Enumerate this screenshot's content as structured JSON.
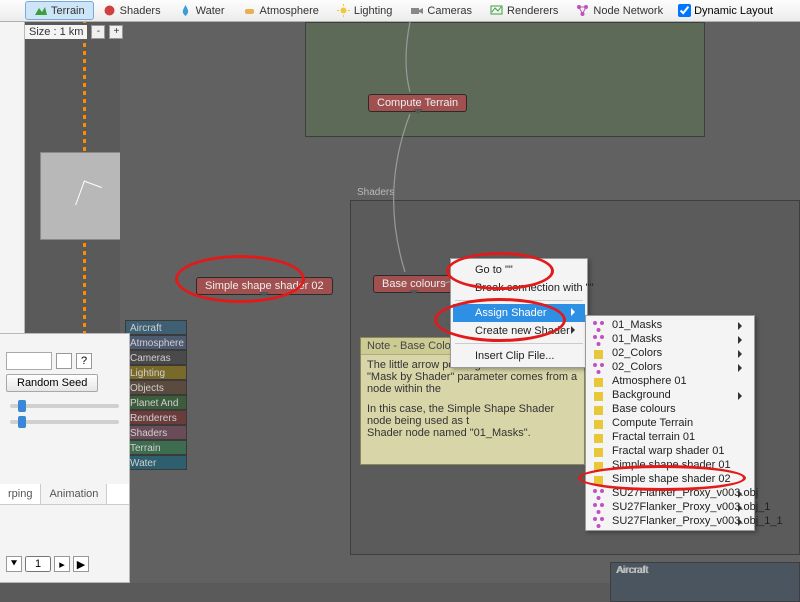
{
  "toolbar": {
    "items": [
      {
        "label": "Terrain",
        "selected": true
      },
      {
        "label": "Shaders"
      },
      {
        "label": "Water"
      },
      {
        "label": "Atmosphere"
      },
      {
        "label": "Lighting"
      },
      {
        "label": "Cameras"
      },
      {
        "label": "Renderers"
      },
      {
        "label": "Node Network"
      }
    ],
    "dynamic_layout": "Dynamic Layout"
  },
  "subtoolbar": {
    "size_label": "Size : 1 km",
    "minus": "-",
    "plus": "+"
  },
  "categories": [
    "Aircraft",
    "Atmosphere",
    "Cameras",
    "Lighting",
    "Objects",
    "Planet And ...",
    "Renderers",
    "Shaders",
    "Terrain",
    "Water"
  ],
  "category_colors": [
    "#3f5f73",
    "#4d5a70",
    "#4a4a4a",
    "#7a6a2a",
    "#5a4b3e",
    "#3c5c3c",
    "#6a3c3c",
    "#6a4c58",
    "#3e6c4e",
    "#2e5f6e"
  ],
  "nodes": {
    "compute_terrain": {
      "label": "Compute Terrain",
      "color": "#a15050"
    },
    "simple_shape": {
      "label": "Simple shape shader 02",
      "color": "#a15050"
    },
    "base_colours": {
      "label": "Base colours",
      "color": "#a15050"
    },
    "mask_placeholder": {
      "label": "Mask by Shader"
    }
  },
  "groups": {
    "terrain_top": {
      "title": ""
    },
    "shaders": {
      "title": "Shaders"
    },
    "aircraft": {
      "title": "Aircraft"
    }
  },
  "note": {
    "title": "Note - Base Colours",
    "line1": "The little arrow pointing",
    "line2": "\"Mask by Shader\" parameter comes from a node within the",
    "line3": "In this case, the Simple Shape Shader node being used as t",
    "line4": "Shader node named \"01_Masks\"."
  },
  "context_menu": {
    "items": [
      {
        "label": "Go to \"\""
      },
      {
        "label": "Break connection with \"\""
      },
      {
        "label": "Assign Shader",
        "sub": true,
        "hl": true
      },
      {
        "label": "Create new Shader",
        "sub": true
      },
      {
        "label": "Insert Clip File..."
      }
    ],
    "submenu": [
      {
        "label": "01_Masks",
        "sub": true,
        "icon": "node"
      },
      {
        "label": "01_Masks",
        "sub": true,
        "icon": "node"
      },
      {
        "label": "02_Colors",
        "sub": true,
        "icon": "yellow"
      },
      {
        "label": "02_Colors",
        "sub": true,
        "icon": "node"
      },
      {
        "label": "Atmosphere 01",
        "icon": "yellow"
      },
      {
        "label": "Background",
        "sub": true,
        "icon": "yellow"
      },
      {
        "label": "Base colours",
        "icon": "yellow"
      },
      {
        "label": "Compute Terrain",
        "icon": "yellow"
      },
      {
        "label": "Fractal terrain 01",
        "icon": "yellow"
      },
      {
        "label": "Fractal warp shader 01",
        "icon": "yellow"
      },
      {
        "label": "Simple shape shader 01",
        "icon": "yellow"
      },
      {
        "label": "Simple shape shader 02",
        "icon": "yellow"
      },
      {
        "label": "SU27Flanker_Proxy_v003.obj",
        "sub": true,
        "icon": "node"
      },
      {
        "label": "SU27Flanker_Proxy_v003.obj_1",
        "sub": true,
        "icon": "node"
      },
      {
        "label": "SU27Flanker_Proxy_v003.obj_1_1",
        "sub": true,
        "icon": "node"
      }
    ]
  },
  "bottom_panel": {
    "tabs": [
      "rping",
      "Animation"
    ],
    "random_seed": "Random Seed",
    "spinner_value": "1"
  },
  "icons": {
    "terrain": "#3e9e3e",
    "shaders": "#d04040",
    "water": "#3a7ed0",
    "atmosphere": "#e0a030",
    "lighting": "#e8c030",
    "cameras": "#808080",
    "renderers": "#3e9e3e",
    "nodenet": "#c050c0"
  }
}
